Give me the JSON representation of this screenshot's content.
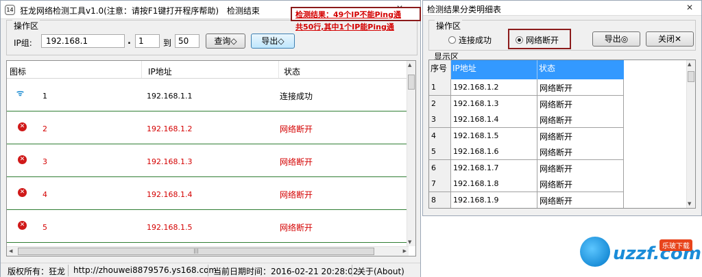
{
  "main_window": {
    "title": "狂龙网络检测工具v1.0(注意：请按F1键打开程序帮助)",
    "title_extra": "检测结束",
    "app_icon_text": "14",
    "minimize_icon": "minimize-icon",
    "close_icon": "close-icon"
  },
  "ops": {
    "group_label": "操作区",
    "ip_label": "IP组:",
    "ip_value": "192.168.1",
    "dot": ".",
    "start_value": "1",
    "to_label": "到",
    "end_value": "50",
    "query_button": "查询◇",
    "export_button": "导出◇",
    "result_line1": "检测结果：49个IP不能Ping通",
    "result_line2": "共50行,其中1个IP能Ping通"
  },
  "list": {
    "headers": [
      "图标",
      "IP地址",
      "状态"
    ],
    "rows": [
      {
        "num": "1",
        "ip": "192.168.1.1",
        "status": "连接成功",
        "icon": "wifi-icon"
      },
      {
        "num": "2",
        "ip": "192.168.1.2",
        "status": "网络断开",
        "icon": "error-icon"
      },
      {
        "num": "3",
        "ip": "192.168.1.3",
        "status": "网络断开",
        "icon": "error-icon"
      },
      {
        "num": "4",
        "ip": "192.168.1.4",
        "status": "网络断开",
        "icon": "error-icon"
      },
      {
        "num": "5",
        "ip": "192.168.1.5",
        "status": "网络断开",
        "icon": "error-icon"
      }
    ]
  },
  "statusbar": {
    "copyright": "版权所有：狂龙",
    "url": "http://zhouwei8879576.ys168.com",
    "date": "当前日期时间：2016-02-21 20:28:02",
    "about": "关于(About)"
  },
  "detail_window": {
    "title": "检测结果分类明细表",
    "ops_label": "操作区",
    "radio_success": "连接成功",
    "radio_disconnected": "网络断开",
    "export_button": "导出◎",
    "close_button": "关闭✕",
    "display_label": "显示区",
    "table_headers": [
      "序号",
      "IP地址",
      "状态"
    ],
    "rows": [
      {
        "seq": "1",
        "ip": "192.168.1.2",
        "status": "网络断开"
      },
      {
        "seq": "2",
        "ip": "192.168.1.3",
        "status": "网络断开"
      },
      {
        "seq": "3",
        "ip": "192.168.1.4",
        "status": "网络断开"
      },
      {
        "seq": "4",
        "ip": "192.168.1.5",
        "status": "网络断开"
      },
      {
        "seq": "5",
        "ip": "192.168.1.6",
        "status": "网络断开"
      },
      {
        "seq": "6",
        "ip": "192.168.1.7",
        "status": "网络断开"
      },
      {
        "seq": "7",
        "ip": "192.168.1.8",
        "status": "网络断开"
      },
      {
        "seq": "8",
        "ip": "192.168.1.9",
        "status": "网络断开"
      }
    ]
  },
  "watermark": {
    "text": "uzzf.com",
    "tag": "乐玻下载"
  },
  "colors": {
    "error_red": "#d40000",
    "row_divider": "#2e7d32",
    "highlight_blue": "#3399ff",
    "annotation_box": "#8b1a1a"
  }
}
